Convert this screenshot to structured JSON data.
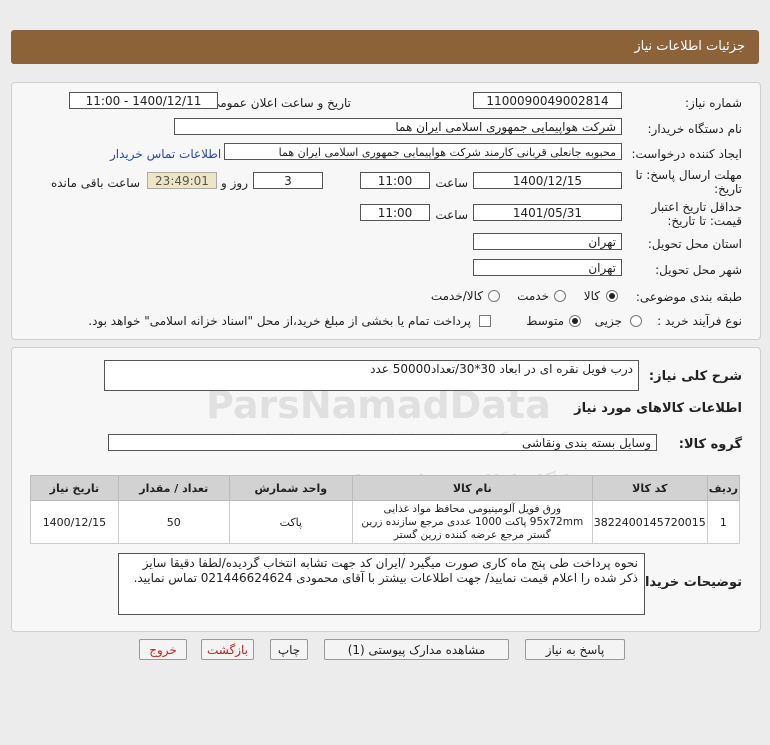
{
  "header": {
    "title": "جزئیات اطلاعات نیاز"
  },
  "form": {
    "need_number_label": "شماره نیاز:",
    "need_number": "1100090049002814",
    "announce_label": "تاریخ و ساعت اعلان عمومی:",
    "announce_value": "1400/12/11 - 11:00",
    "buyer_org_label": "نام دستگاه خریدار:",
    "buyer_org": "شرکت هواپیمایی جمهوری اسلامی ایران هما",
    "requester_label": "ایجاد کننده درخواست:",
    "requester": "محبوبه جانعلی قربانی کارمند شرکت هواپیمایی جمهوری اسلامی ایران هما",
    "contact_link": "اطلاعات تماس خریدار",
    "send_deadline_label_1": "مهلت ارسال پاسخ: تا",
    "send_deadline_label_2": "تاریخ:",
    "send_date": "1400/12/15",
    "hour_label": "ساعت",
    "send_time": "11:00",
    "days_value": "3",
    "days_label": "روز و",
    "remaining_time": "23:49:01",
    "remaining_label": "ساعت باقی مانده",
    "validity_label_1": "حداقل تاریخ اعتبار",
    "validity_label_2": "قیمت: تا تاریخ:",
    "validity_date": "1401/05/31",
    "validity_hour_label": "ساعت",
    "validity_time": "11:00",
    "province_label": "استان محل تحویل:",
    "province": "تهران",
    "city_label": "شهر محل تحویل:",
    "city": "تهران",
    "category_label": "طبقه بندی موضوعی:",
    "category_options": [
      "کالا",
      "خدمت",
      "کالا/خدمت"
    ],
    "process_label": "نوع فرآیند خرید :",
    "process_options": [
      "جزیی",
      "متوسط"
    ],
    "payment_note": "پرداخت تمام یا بخشی از مبلغ خرید،از محل \"اسناد خزانه اسلامی\" خواهد بود."
  },
  "details": {
    "general_desc_label": "شرح کلی نیاز:",
    "general_desc": "درب فویل نقره ای در ابعاد 30*30/تعداد50000 عدد",
    "goods_info_title": "اطلاعات کالاهای مورد نیاز",
    "goods_group_label": "گروه کالا:",
    "goods_group": "وسایل بسته بندی  ونقاشی",
    "table": {
      "headers": [
        "ردیف",
        "کد کالا",
        "نام کالا",
        "واحد شمارش",
        "تعداد / مقدار",
        "تاریخ نیاز"
      ],
      "rows": [
        {
          "row": "1",
          "code": "3822400145720015",
          "name": "ورق فویل آلومینیومی محافظ مواد غذایی 95x72mm پاکت 1000 عددی مرجع سازنده زرین گستر مرجع عرضه کننده زرین گستر",
          "unit": "پاکت",
          "qty": "50",
          "date": "1400/12/15"
        }
      ]
    },
    "buyer_notes_label": "توضیحات خریدار:",
    "buyer_notes": "نحوه پرداخت طی پنج ماه کاری صورت میگیرد /ایران کد جهت تشابه انتخاب گردیده/لطفا دقیقا سایز ذکر شده را اعلام قیمت نمایید/ جهت اطلاعات بیشتر با آقای محمودی 021446624624 تماس نمایید."
  },
  "buttons": {
    "reply": "پاسخ به نیاز",
    "attachments": "مشاهده مدارک پیوستی (1)",
    "print": "چاپ",
    "back": "بازگشت",
    "exit": "خروج"
  },
  "watermark": {
    "brand": "ParsNamadData",
    "line1": "پایگاه اطلاع رسانی مناقصه",
    "line2": "گروه فناوری اطلاعات پارس نماد داده ها",
    "phone": "۰۲۱-۸۸۳۴۶"
  }
}
